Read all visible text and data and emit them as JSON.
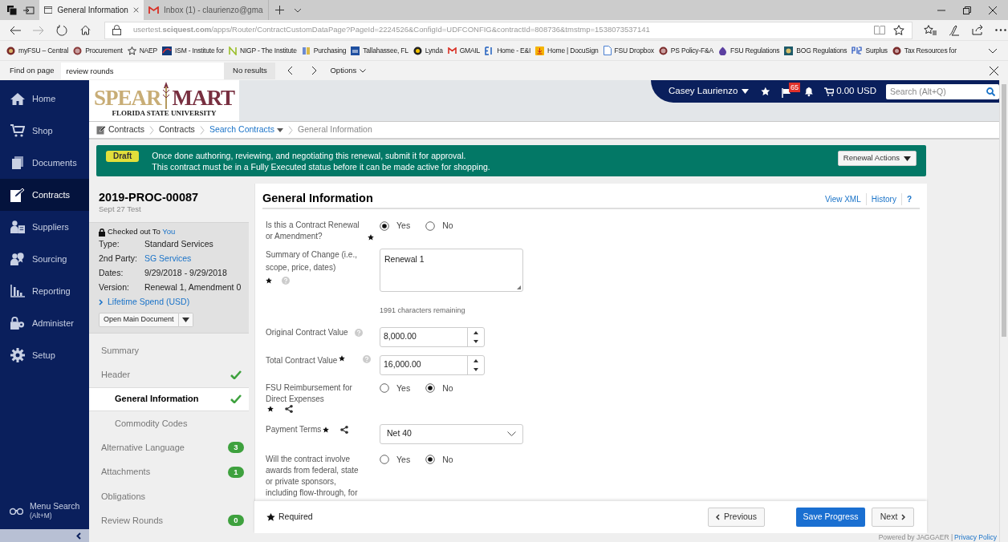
{
  "browser": {
    "tabs": [
      {
        "title": "General Information",
        "selected": true
      },
      {
        "title": "Inbox (1) - claurienzo@gma",
        "selected": false
      }
    ],
    "url": "usertest.**sciquest.com**/apps/Router/ContractCustomDataPage?PageId=2224526&ConfigId=UDFCONFIG&contractId=808736&tmstmp=1538073537141",
    "favorites": [
      {
        "label": "myFSU – Central"
      },
      {
        "label": "Procurement"
      },
      {
        "label": "NAEP"
      },
      {
        "label": "ISM - Institute for"
      },
      {
        "label": "NIGP - The Institute"
      },
      {
        "label": "Purchasing"
      },
      {
        "label": "Tallahassee, FL"
      },
      {
        "label": "Lynda"
      },
      {
        "label": "GMAIL"
      },
      {
        "label": "Home - E&I"
      },
      {
        "label": "Home | DocuSign"
      },
      {
        "label": "FSU Dropbox"
      },
      {
        "label": "PS Policy-F&A"
      },
      {
        "label": "FSU Regulations"
      },
      {
        "label": "BOG Regulations"
      },
      {
        "label": "Surplus"
      },
      {
        "label": "Tax Resources for"
      }
    ],
    "find_bar": {
      "label": "Find on page",
      "value": "review rounds",
      "result": "No results",
      "options": "Options"
    }
  },
  "nav": {
    "items": [
      {
        "label": "Home",
        "selected": false
      },
      {
        "label": "Shop",
        "selected": false
      },
      {
        "label": "Documents",
        "selected": false
      },
      {
        "label": "Contracts",
        "selected": true
      },
      {
        "label": "Suppliers",
        "selected": false
      },
      {
        "label": "Sourcing",
        "selected": false
      },
      {
        "label": "Reporting",
        "selected": false
      },
      {
        "label": "Administer",
        "selected": false
      },
      {
        "label": "Setup",
        "selected": false
      }
    ],
    "menu_search": {
      "label": "Menu Search",
      "shortcut": "(Alt+M)"
    }
  },
  "header": {
    "logo": {
      "word_1": "SPEAR",
      "word_2": "MART",
      "subtitle": "FLORIDA STATE UNIVERSITY"
    },
    "user": "Casey Laurienzo",
    "flag_count": "65",
    "cart": "0.00 USD",
    "search_placeholder": "Search (Alt+Q)"
  },
  "breadcrumb": [
    {
      "label": "Contracts",
      "kind": "plain"
    },
    {
      "label": "Contracts",
      "kind": "plain"
    },
    {
      "label": "Search Contracts",
      "kind": "link"
    },
    {
      "label": "General Information",
      "kind": "current"
    }
  ],
  "banner": {
    "status": "Draft",
    "lines": [
      "Once done authoring, reviewing, and negotiating this renewal, submit it for approval.",
      "This contract must be in a Fully Executed status before it can be made active for shopping."
    ],
    "button": "Renewal Actions"
  },
  "contract": {
    "number": "2019-PROC-00087",
    "subtitle": "Sept 27 Test",
    "checked_out": "Checked out To",
    "checked_out_user": "You",
    "details": [
      {
        "label": "Type:",
        "value": "Standard Services",
        "kind": "text"
      },
      {
        "label": "2nd Party:",
        "value": "SG Services",
        "kind": "link"
      },
      {
        "label": "Dates:",
        "value": "9/29/2018 - 9/29/2018",
        "kind": "text"
      },
      {
        "label": "Version:",
        "value": "Renewal 1, Amendment 0",
        "kind": "text"
      }
    ],
    "lifetime_spend": "Lifetime Spend (USD)",
    "open_document": "Open Main Document"
  },
  "sections": [
    {
      "label": "Summary",
      "selected": false,
      "complete": false
    },
    {
      "label": "Header",
      "selected": false,
      "complete": true,
      "children": [
        {
          "label": "General Information",
          "selected": true,
          "complete": true
        },
        {
          "label": "Commodity Codes",
          "selected": false,
          "complete": false
        }
      ]
    },
    {
      "label": "Alternative Language",
      "selected": false,
      "complete": false,
      "count": "3"
    },
    {
      "label": "Attachments",
      "selected": false,
      "complete": false,
      "count": "1"
    },
    {
      "label": "Obligations",
      "selected": false,
      "complete": false
    },
    {
      "label": "Review Rounds",
      "selected": false,
      "complete": false,
      "count": "0"
    }
  ],
  "form": {
    "title": "General Information",
    "links": [
      "View XML",
      "History",
      "?"
    ],
    "fields": [
      {
        "kind": "radio",
        "label": "Is this a Contract Renewal or Amendment?",
        "required": true,
        "help": false,
        "shared": false,
        "options": [
          {
            "label": "Yes",
            "selected": true
          },
          {
            "label": "No",
            "selected": false
          }
        ]
      },
      {
        "kind": "textarea",
        "label": "Summary of Change (i.e., scope, price, dates)",
        "required": true,
        "help": true,
        "shared": false,
        "value": "Renewal 1",
        "note": "1991 characters remaining"
      },
      {
        "kind": "number",
        "label": "Original Contract Value",
        "required": false,
        "help": true,
        "shared": false,
        "value": "8,000.00"
      },
      {
        "kind": "number",
        "label": "Total Contract Value",
        "required": true,
        "help": true,
        "shared": false,
        "value": "16,000.00"
      },
      {
        "kind": "radio",
        "label": "FSU Reimbursement for Direct Expenses",
        "required": true,
        "help": false,
        "shared": true,
        "options": [
          {
            "label": "Yes",
            "selected": false
          },
          {
            "label": "No",
            "selected": true
          }
        ]
      },
      {
        "kind": "select",
        "label": "Payment Terms",
        "required": true,
        "help": false,
        "shared": true,
        "value": "Net 40"
      },
      {
        "kind": "radio",
        "label": "Will the contract involve awards from federal, state or private sponsors, including flow-through, for",
        "help": false,
        "shared": false,
        "options": [
          {
            "label": "Yes",
            "selected": false
          },
          {
            "label": "No",
            "selected": true
          }
        ]
      }
    ]
  },
  "footer": {
    "required_note": "Required",
    "buttons": [
      {
        "label": "Previous",
        "kind": "back"
      },
      {
        "label": "Save Progress",
        "kind": "primary"
      },
      {
        "label": "Next",
        "kind": "forward"
      }
    ]
  },
  "powered_by": "Powered by JAGGAER |",
  "privacy_link": "Privacy Policy"
}
